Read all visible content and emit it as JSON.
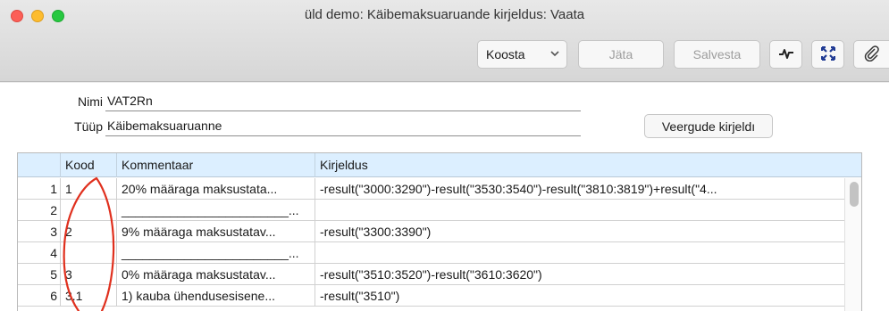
{
  "window": {
    "title": "üld demo: Käibemaksuaruande kirjeldus: Vaata"
  },
  "toolbar": {
    "select_value": "Koosta",
    "jata_label": "Jäta",
    "salvesta_label": "Salvesta"
  },
  "form": {
    "nimi_label": "Nimi",
    "nimi_value": "VAT2Rn",
    "tuup_label": "Tüüp",
    "tuup_value": "Käibemaksuaruanne",
    "veergude_button": "Veergude kirjeldı"
  },
  "grid": {
    "columns": [
      "",
      "Kood",
      "Kommentaar",
      "Kirjeldus"
    ],
    "rows": [
      {
        "num": "1",
        "kood": "1",
        "kommentaar": "20% määraga maksustata...",
        "kirjeldus": "-result(\"3000:3290\")-result(\"3530:3540\")-result(\"3810:3819\")+result(\"4..."
      },
      {
        "num": "2",
        "kood": "",
        "kommentaar": "________________________...",
        "kirjeldus": ""
      },
      {
        "num": "3",
        "kood": "2",
        "kommentaar": "9% määraga maksustatav...",
        "kirjeldus": "-result(\"3300:3390\")"
      },
      {
        "num": "4",
        "kood": "",
        "kommentaar": "________________________...",
        "kirjeldus": ""
      },
      {
        "num": "5",
        "kood": "3",
        "kommentaar": "0% määraga maksustatav...",
        "kirjeldus": "-result(\"3510:3520\")-result(\"3610:3620\")"
      },
      {
        "num": "6",
        "kood": "3.1",
        "kommentaar": "1) kauba ühendusesisene...",
        "kirjeldus": "-result(\"3510\")"
      }
    ]
  },
  "colors": {
    "header_bg": "#dcefff",
    "annotation": "#e0301e"
  },
  "icons": {
    "wave": "activity-wave-icon",
    "expand": "expand-arrows-icon",
    "clip": "paperclip-icon"
  }
}
